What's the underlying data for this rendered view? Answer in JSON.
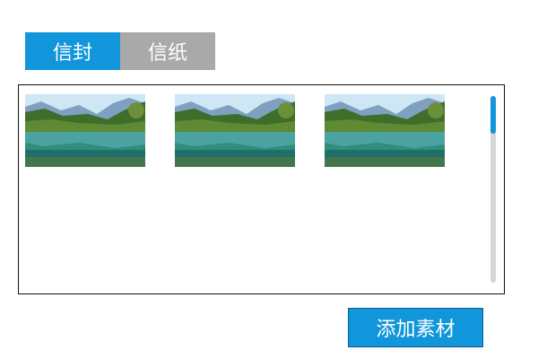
{
  "tabs": [
    {
      "label": "信封",
      "active": true
    },
    {
      "label": "信纸",
      "active": false
    }
  ],
  "materials": [
    {
      "icon": "landscape-image"
    },
    {
      "icon": "landscape-image"
    },
    {
      "icon": "landscape-image"
    }
  ],
  "scroll_position": 0,
  "add_button": {
    "label": "添加素材"
  },
  "colors": {
    "accent": "#1296db",
    "inactive_tab": "#a9a9a9"
  }
}
